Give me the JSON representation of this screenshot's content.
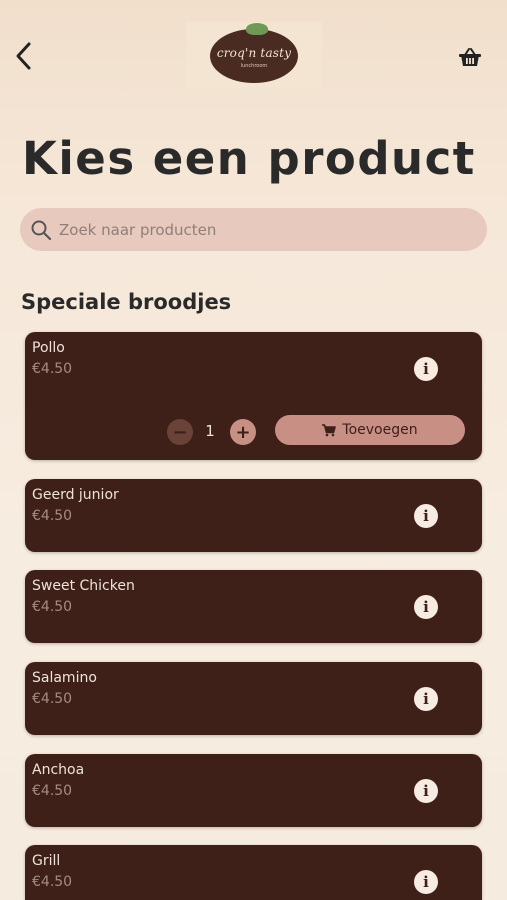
{
  "header": {
    "logo_text": "croq'n tasty",
    "logo_subtext": "lunchroom"
  },
  "page_title": "Kies een product",
  "search": {
    "placeholder": "Zoek naar producten",
    "value": ""
  },
  "section": {
    "title": "Speciale broodjes"
  },
  "products": [
    {
      "name": "Pollo",
      "price": "€4.50",
      "expanded": true,
      "quantity": "1",
      "add_label": "Toevoegen"
    },
    {
      "name": "Geerd junior",
      "price": "€4.50"
    },
    {
      "name": "Sweet Chicken",
      "price": "€4.50"
    },
    {
      "name": "Salamino",
      "price": "€4.50"
    },
    {
      "name": "Anchoa",
      "price": "€4.50"
    },
    {
      "name": "Grill",
      "price": "€4.50"
    }
  ],
  "icons": {
    "back": "chevron-left-icon",
    "basket": "basket-icon",
    "search": "search-icon",
    "info": "info-icon",
    "cart": "cart-icon"
  },
  "colors": {
    "card_bg": "#3e2019",
    "accent": "#c89085",
    "search_bg": "#e8c9bd"
  }
}
